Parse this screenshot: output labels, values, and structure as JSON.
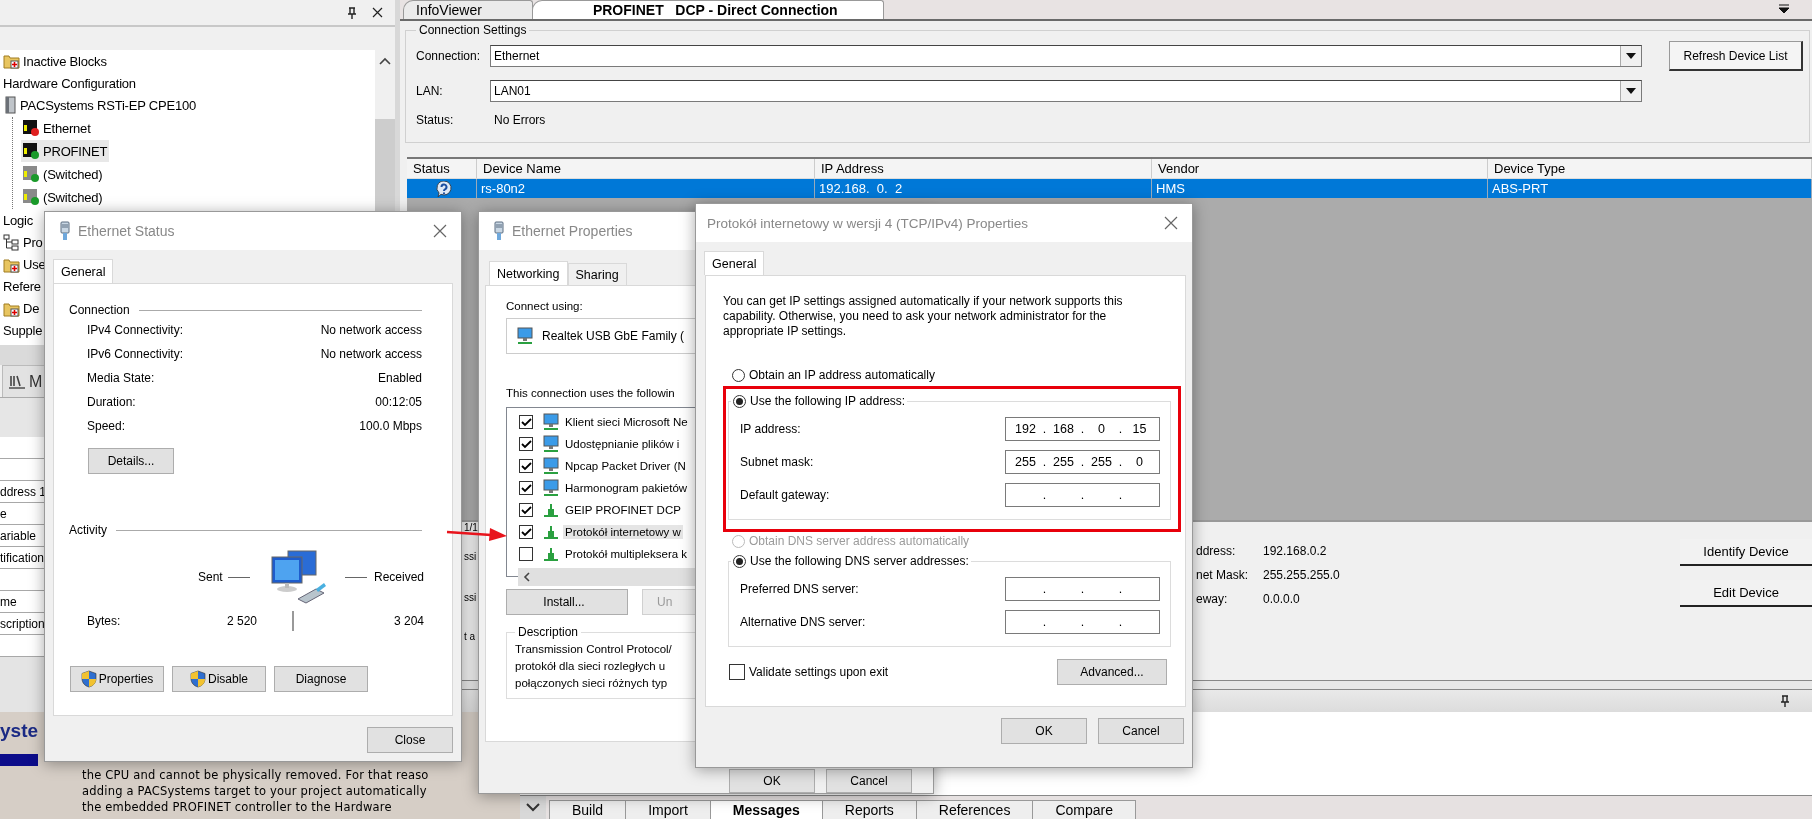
{
  "left_panel": {
    "tree": [
      {
        "label": "Inactive Blocks",
        "kind": "folder",
        "selected": false
      },
      {
        "label": "Hardware Configuration",
        "kind": "plain",
        "selected": false,
        "children": [
          {
            "label": "PACSystems RSTi-EP CPE100",
            "kind": "module",
            "selected": false,
            "children": [
              {
                "label": "Ethernet",
                "kind": "port-error",
                "selected": false
              },
              {
                "label": "PROFINET",
                "kind": "port",
                "selected": true
              },
              {
                "label": "(Switched)",
                "kind": "port-idle",
                "selected": false
              },
              {
                "label": "(Switched)",
                "kind": "port-idle",
                "selected": false
              }
            ]
          }
        ]
      },
      {
        "label": "Logic",
        "kind": "plain",
        "selected": false
      },
      {
        "label": "Pro",
        "kind": "hierarchy",
        "selected": false
      },
      {
        "label": "Use",
        "kind": "folder",
        "selected": false
      },
      {
        "label": "Refere",
        "kind": "plain",
        "selected": false
      },
      {
        "label": "De",
        "kind": "folder",
        "selected": false
      },
      {
        "label": "Supple",
        "kind": "plain",
        "selected": false
      }
    ],
    "panel_tab": "M",
    "property_rows": [
      {
        "kind": "blank"
      },
      {
        "kind": "blank"
      },
      {
        "kind": "text",
        "label": "ddress 1"
      },
      {
        "kind": "text",
        "label": "e"
      },
      {
        "kind": "text",
        "label": "ariable"
      },
      {
        "kind": "text",
        "label": "tification"
      },
      {
        "kind": "blank"
      },
      {
        "kind": "text",
        "label": "me"
      },
      {
        "kind": "text",
        "label": "scription"
      },
      {
        "kind": "blank"
      }
    ],
    "help": {
      "heading": "yste",
      "lines": [
        "the CPU and cannot be physically removed. For that reaso",
        "adding a PACSystems target to your project automatically",
        "the embedded PROFINET controller to the Hardware"
      ]
    }
  },
  "main": {
    "document_tabs": [
      {
        "label": "InfoViewer",
        "selected": false
      },
      {
        "label": "PROFINET   DCP - Direct Connection",
        "selected": true
      }
    ],
    "connection_settings": {
      "heading": "Connection Settings",
      "fields": [
        {
          "label": "Connection:",
          "value": "Ethernet",
          "kind": "combo"
        },
        {
          "label": "LAN:",
          "value": "LAN01",
          "kind": "combo"
        },
        {
          "label": "Status:",
          "value": "No Errors",
          "kind": "text"
        }
      ],
      "refresh_button": "Refresh Device List"
    },
    "devices": {
      "columns": [
        "Status",
        "Device Name",
        "IP Address",
        "Vendor",
        "Device Type"
      ],
      "rows": [
        {
          "cells": [
            "",
            "rs-80n2",
            "192.168.  0.  2",
            "HMS",
            "ABS-PRT"
          ],
          "selected": true
        }
      ]
    },
    "message_fragments": [
      "1/1",
      "ssi",
      "ssi",
      "t a"
    ],
    "device_details": [
      {
        "label": "ddress:",
        "value": "192.168.0.2"
      },
      {
        "label": "net Mask:",
        "value": "255.255.255.0"
      },
      {
        "label": "eway:",
        "value": "0.0.0.0"
      }
    ],
    "device_buttons": [
      "Identify Device",
      "Edit Device"
    ],
    "bottom_tabs": [
      {
        "label": "Build",
        "selected": false
      },
      {
        "label": "Import",
        "selected": false
      },
      {
        "label": "Messages",
        "selected": true
      },
      {
        "label": "Reports",
        "selected": false
      },
      {
        "label": "References",
        "selected": false
      },
      {
        "label": "Compare",
        "selected": false
      }
    ]
  },
  "ethernet_status_dialog": {
    "title": "Ethernet Status",
    "tabs": [
      {
        "label": "General",
        "selected": true
      }
    ],
    "connection_heading": "Connection",
    "connection_rows": [
      {
        "label": "IPv4 Connectivity:",
        "value": "No network access"
      },
      {
        "label": "IPv6 Connectivity:",
        "value": "No network access"
      },
      {
        "label": "Media State:",
        "value": "Enabled"
      },
      {
        "label": "Duration:",
        "value": "00:12:05"
      },
      {
        "label": "Speed:",
        "value": "100.0 Mbps"
      }
    ],
    "details_button": "Details...",
    "activity_heading": "Activity",
    "sent_label": "Sent",
    "received_label": "Received",
    "bytes_label": "Bytes:",
    "bytes_sent": "2 520",
    "bytes_received": "3 204",
    "buttons": [
      {
        "label": "Properties",
        "shield": true
      },
      {
        "label": "Disable",
        "shield": true
      },
      {
        "label": "Diagnose",
        "shield": false
      }
    ],
    "close_button": "Close"
  },
  "ethernet_properties_dialog": {
    "title": "Ethernet Properties",
    "tabs": [
      {
        "label": "Networking",
        "selected": true
      },
      {
        "label": "Sharing",
        "selected": false
      }
    ],
    "connect_using_label": "Connect using:",
    "adapter": "Realtek USB GbE Family (",
    "items_label": "This connection uses the followin",
    "items": [
      {
        "label": "Klient sieci Microsoft Ne",
        "checked": true,
        "selected": false,
        "kind": "computer"
      },
      {
        "label": "Udostępnianie plików i",
        "checked": true,
        "selected": false,
        "kind": "computer"
      },
      {
        "label": "Npcap Packet Driver (N",
        "checked": true,
        "selected": false,
        "kind": "computer"
      },
      {
        "label": "Harmonogram pakietów",
        "checked": true,
        "selected": false,
        "kind": "computer"
      },
      {
        "label": "GEIP PROFINET DCP",
        "checked": true,
        "selected": false,
        "kind": "protocol"
      },
      {
        "label": "Protokół internetowy w",
        "checked": true,
        "selected": true,
        "kind": "protocol"
      },
      {
        "label": "Protokół multipleksera k",
        "checked": false,
        "selected": false,
        "kind": "protocol"
      }
    ],
    "buttons": [
      {
        "label": "Install...",
        "disabled": false
      },
      {
        "label": "Un",
        "disabled": true
      }
    ],
    "description_heading": "Description",
    "description_lines": [
      "Transmission Control Protocol/",
      "protokół dla sieci rozległych u",
      "połączonych sieci różnych typ"
    ],
    "footer_buttons": [
      "OK",
      "Cancel"
    ]
  },
  "ipv4_properties_dialog": {
    "title": "Protokół internetowy w wersji 4 (TCP/IPv4) Properties",
    "tabs": [
      {
        "label": "General",
        "selected": true
      }
    ],
    "intro": "You can get IP settings assigned automatically if your network supports this capability. Otherwise, you need to ask your network administrator for the appropriate IP settings.",
    "separator": ".",
    "ip_mode": [
      {
        "label": "Obtain an IP address automatically",
        "selected": false,
        "disabled": false
      },
      {
        "label": "Use the following IP address:",
        "selected": true,
        "disabled": false
      }
    ],
    "ip_fields": [
      {
        "label": "IP address:",
        "octets": [
          "192",
          "168",
          "0",
          "15"
        ]
      },
      {
        "label": "Subnet mask:",
        "octets": [
          "255",
          "255",
          "255",
          "0"
        ]
      },
      {
        "label": "Default gateway:"
      }
    ],
    "dns_mode": [
      {
        "label": "Obtain DNS server address automatically",
        "selected": false,
        "disabled": true
      },
      {
        "label": "Use the following DNS server addresses:",
        "selected": true,
        "disabled": false
      }
    ],
    "dns_fields": [
      {
        "label": "Preferred DNS server:"
      },
      {
        "label": "Alternative DNS server:"
      }
    ],
    "validate": {
      "label": "Validate settings upon exit",
      "checked": false
    },
    "advanced_button": "Advanced...",
    "buttons": [
      "OK",
      "Cancel"
    ]
  }
}
